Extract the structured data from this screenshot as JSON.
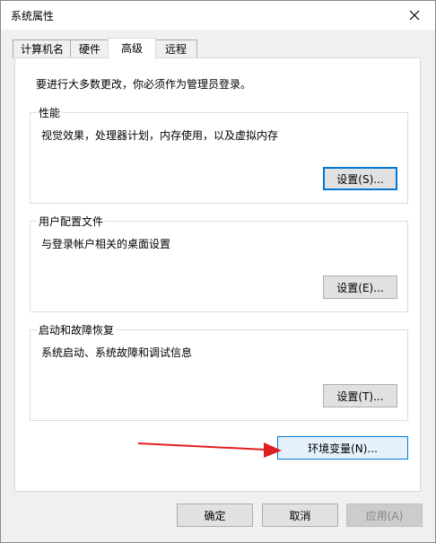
{
  "window": {
    "title": "系统属性"
  },
  "tabs": [
    {
      "label": "计算机名"
    },
    {
      "label": "硬件"
    },
    {
      "label": "高级",
      "active": true
    },
    {
      "label": "远程"
    }
  ],
  "advanced": {
    "notice": "要进行大多数更改，你必须作为管理员登录。",
    "performance": {
      "title": "性能",
      "description": "视觉效果，处理器计划，内存使用，以及虚拟内存",
      "button": "设置(S)..."
    },
    "user_profiles": {
      "title": "用户配置文件",
      "description": "与登录帐户相关的桌面设置",
      "button": "设置(E)..."
    },
    "startup_recovery": {
      "title": "启动和故障恢复",
      "description": "系统启动、系统故障和调试信息",
      "button": "设置(T)..."
    },
    "env_button": "环境变量(N)..."
  },
  "footer": {
    "ok": "确定",
    "cancel": "取消",
    "apply": "应用(A)"
  },
  "annotation": {
    "arrow_color": "#e02020"
  },
  "colors": {
    "focus": "#0078d7",
    "panel_bg": "#f0f0f0"
  }
}
